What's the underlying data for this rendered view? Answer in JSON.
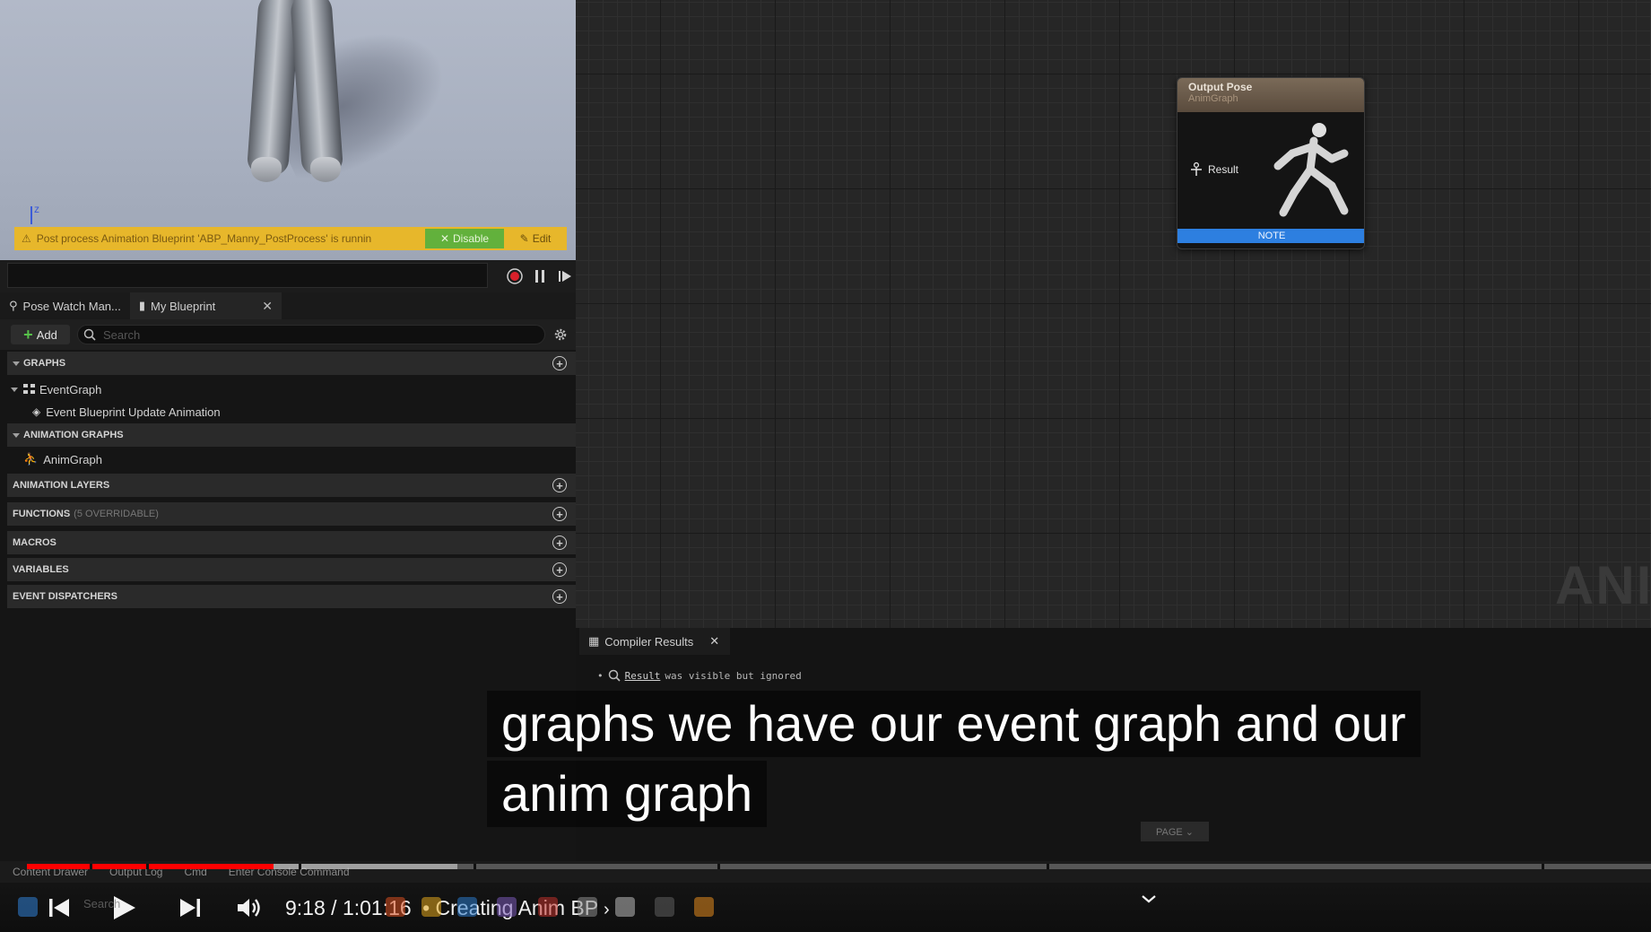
{
  "viewport": {
    "axis_label": "z",
    "warning": "Post process Animation Blueprint 'ABP_Manny_PostProcess' is runnin",
    "disable_label": "Disable",
    "edit_label": "Edit"
  },
  "left_panel": {
    "tabs": [
      {
        "label": "Pose Watch Man..."
      },
      {
        "label": "My Blueprint"
      }
    ],
    "add_label": "Add",
    "search_placeholder": "Search",
    "sections": {
      "graphs": "GRAPHS",
      "animation_graphs": "ANIMATION GRAPHS",
      "animation_layers": "ANIMATION LAYERS",
      "functions": "FUNCTIONS",
      "functions_sub": "(5 OVERRIDABLE)",
      "macros": "MACROS",
      "variables": "VARIABLES",
      "event_dispatchers": "EVENT DISPATCHERS"
    },
    "items": {
      "event_graph": "EventGraph",
      "event_update": "Event Blueprint Update Animation",
      "anim_graph": "AnimGraph"
    }
  },
  "graph": {
    "node": {
      "title": "Output Pose",
      "subtitle": "AnimGraph",
      "pin": "Result",
      "note": "NOTE"
    },
    "watermark": "ANIM"
  },
  "compiler": {
    "tab_label": "Compiler Results",
    "message_link": "Result",
    "message_rest": "was visible but ignored",
    "page_button": "PAGE"
  },
  "caption": {
    "line1": "graphs we have our event graph and our",
    "line2": "anim graph"
  },
  "status_bar": {
    "content_drawer": "Content Drawer",
    "output_log": "Output Log",
    "cmd": "Cmd",
    "console": "Enter Console Command"
  },
  "player": {
    "current_time": "9:18",
    "duration": "1:01:16",
    "separator": " / ",
    "chapter": "• Creating Anim BP",
    "progress_fraction": 0.1518,
    "buffered_fraction": 0.265,
    "search_text": "Search"
  },
  "colors": {
    "accent_red": "#ff0000",
    "warning_yellow": "#e7b72b",
    "disable_green": "#62b13c",
    "note_blue": "#2d7fe0"
  }
}
